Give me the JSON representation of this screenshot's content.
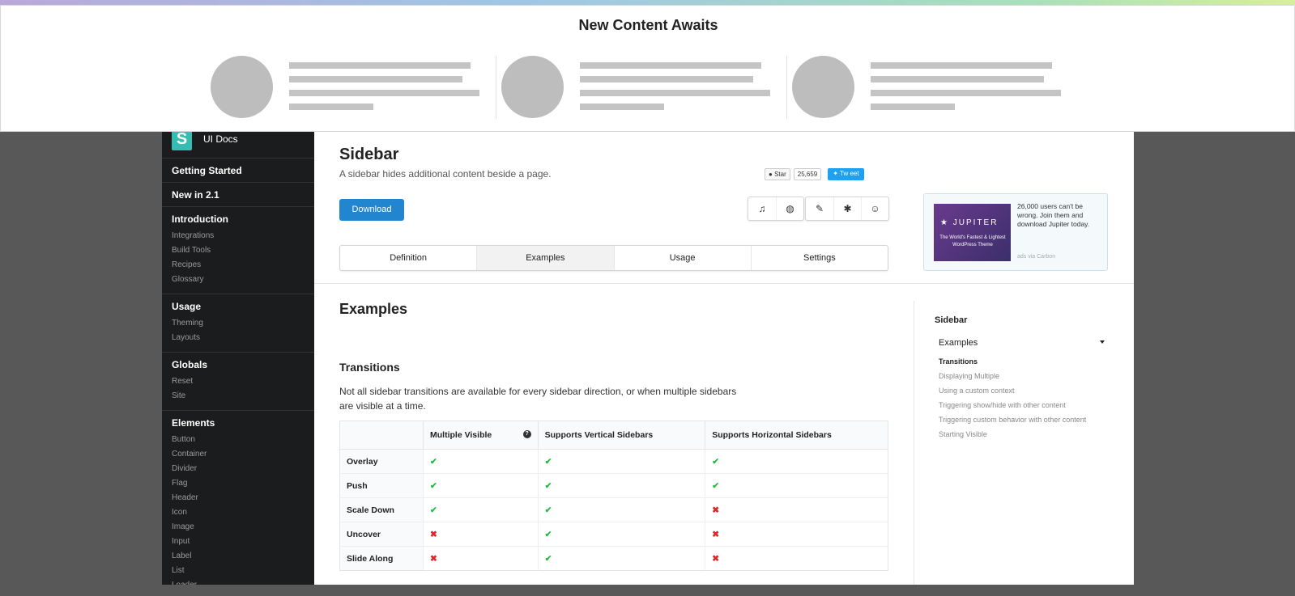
{
  "overlay": {
    "title": "New Content Awaits"
  },
  "nav": {
    "brand": "UI Docs",
    "logo_letter": "S",
    "items": [
      "Getting Started",
      "New in 2.1"
    ],
    "groups": [
      {
        "title": "Introduction",
        "links": [
          "Integrations",
          "Build Tools",
          "Recipes",
          "Glossary"
        ]
      },
      {
        "title": "Usage",
        "links": [
          "Theming",
          "Layouts"
        ]
      },
      {
        "title": "Globals",
        "links": [
          "Reset",
          "Site"
        ]
      },
      {
        "title": "Elements",
        "links": [
          "Button",
          "Container",
          "Divider",
          "Flag",
          "Header",
          "Icon",
          "Image",
          "Input",
          "Label",
          "List",
          "Loader"
        ]
      }
    ]
  },
  "header": {
    "title": "Sidebar",
    "subtitle": "A sidebar hides additional content beside a page.",
    "download_label": "Download",
    "github": {
      "star_label": "Star",
      "star_count": "25,659",
      "tweet_label": "Tw eet"
    }
  },
  "toolbar_icons": [
    "music-icon",
    "globe-icon",
    "edit-icon",
    "bug-icon",
    "github-icon"
  ],
  "tabs": [
    {
      "label": "Definition",
      "active": false
    },
    {
      "label": "Examples",
      "active": true
    },
    {
      "label": "Usage",
      "active": false
    },
    {
      "label": "Settings",
      "active": false
    }
  ],
  "ad": {
    "brand": "JUPITER",
    "tagline": "The World's Fastest & Lightest WordPress Theme",
    "text": "26,000 users can't be wrong. Join them and download Jupiter today.",
    "via": "ads via Carbon"
  },
  "content": {
    "heading": "Examples",
    "subheading": "Transitions",
    "paragraph": "Not all sidebar transitions are available for every sidebar direction, or when multiple sidebars are visible at a time.",
    "table": {
      "columns": [
        "",
        "Multiple Visible",
        "Supports Vertical Sidebars",
        "Supports Horizontal Sidebars"
      ],
      "rows": [
        {
          "name": "Overlay",
          "values": [
            true,
            true,
            true
          ]
        },
        {
          "name": "Push",
          "values": [
            true,
            true,
            true
          ]
        },
        {
          "name": "Scale Down",
          "values": [
            true,
            true,
            false
          ]
        },
        {
          "name": "Uncover",
          "values": [
            false,
            true,
            false
          ]
        },
        {
          "name": "Slide Along",
          "values": [
            false,
            true,
            false
          ]
        }
      ],
      "yes_glyph": "✔",
      "no_glyph": "✖",
      "colors": {
        "yes": "#21ba45",
        "no": "#db2828"
      }
    }
  },
  "toc": {
    "title": "Sidebar",
    "section": "Examples",
    "links": [
      {
        "label": "Transitions",
        "active": true
      },
      {
        "label": "Displaying Multiple",
        "active": false
      },
      {
        "label": "Using a custom context",
        "active": false
      },
      {
        "label": "Triggering show/hide with other content",
        "active": false
      },
      {
        "label": "Triggering custom behavior with other content",
        "active": false
      },
      {
        "label": "Starting Visible",
        "active": false
      }
    ]
  }
}
